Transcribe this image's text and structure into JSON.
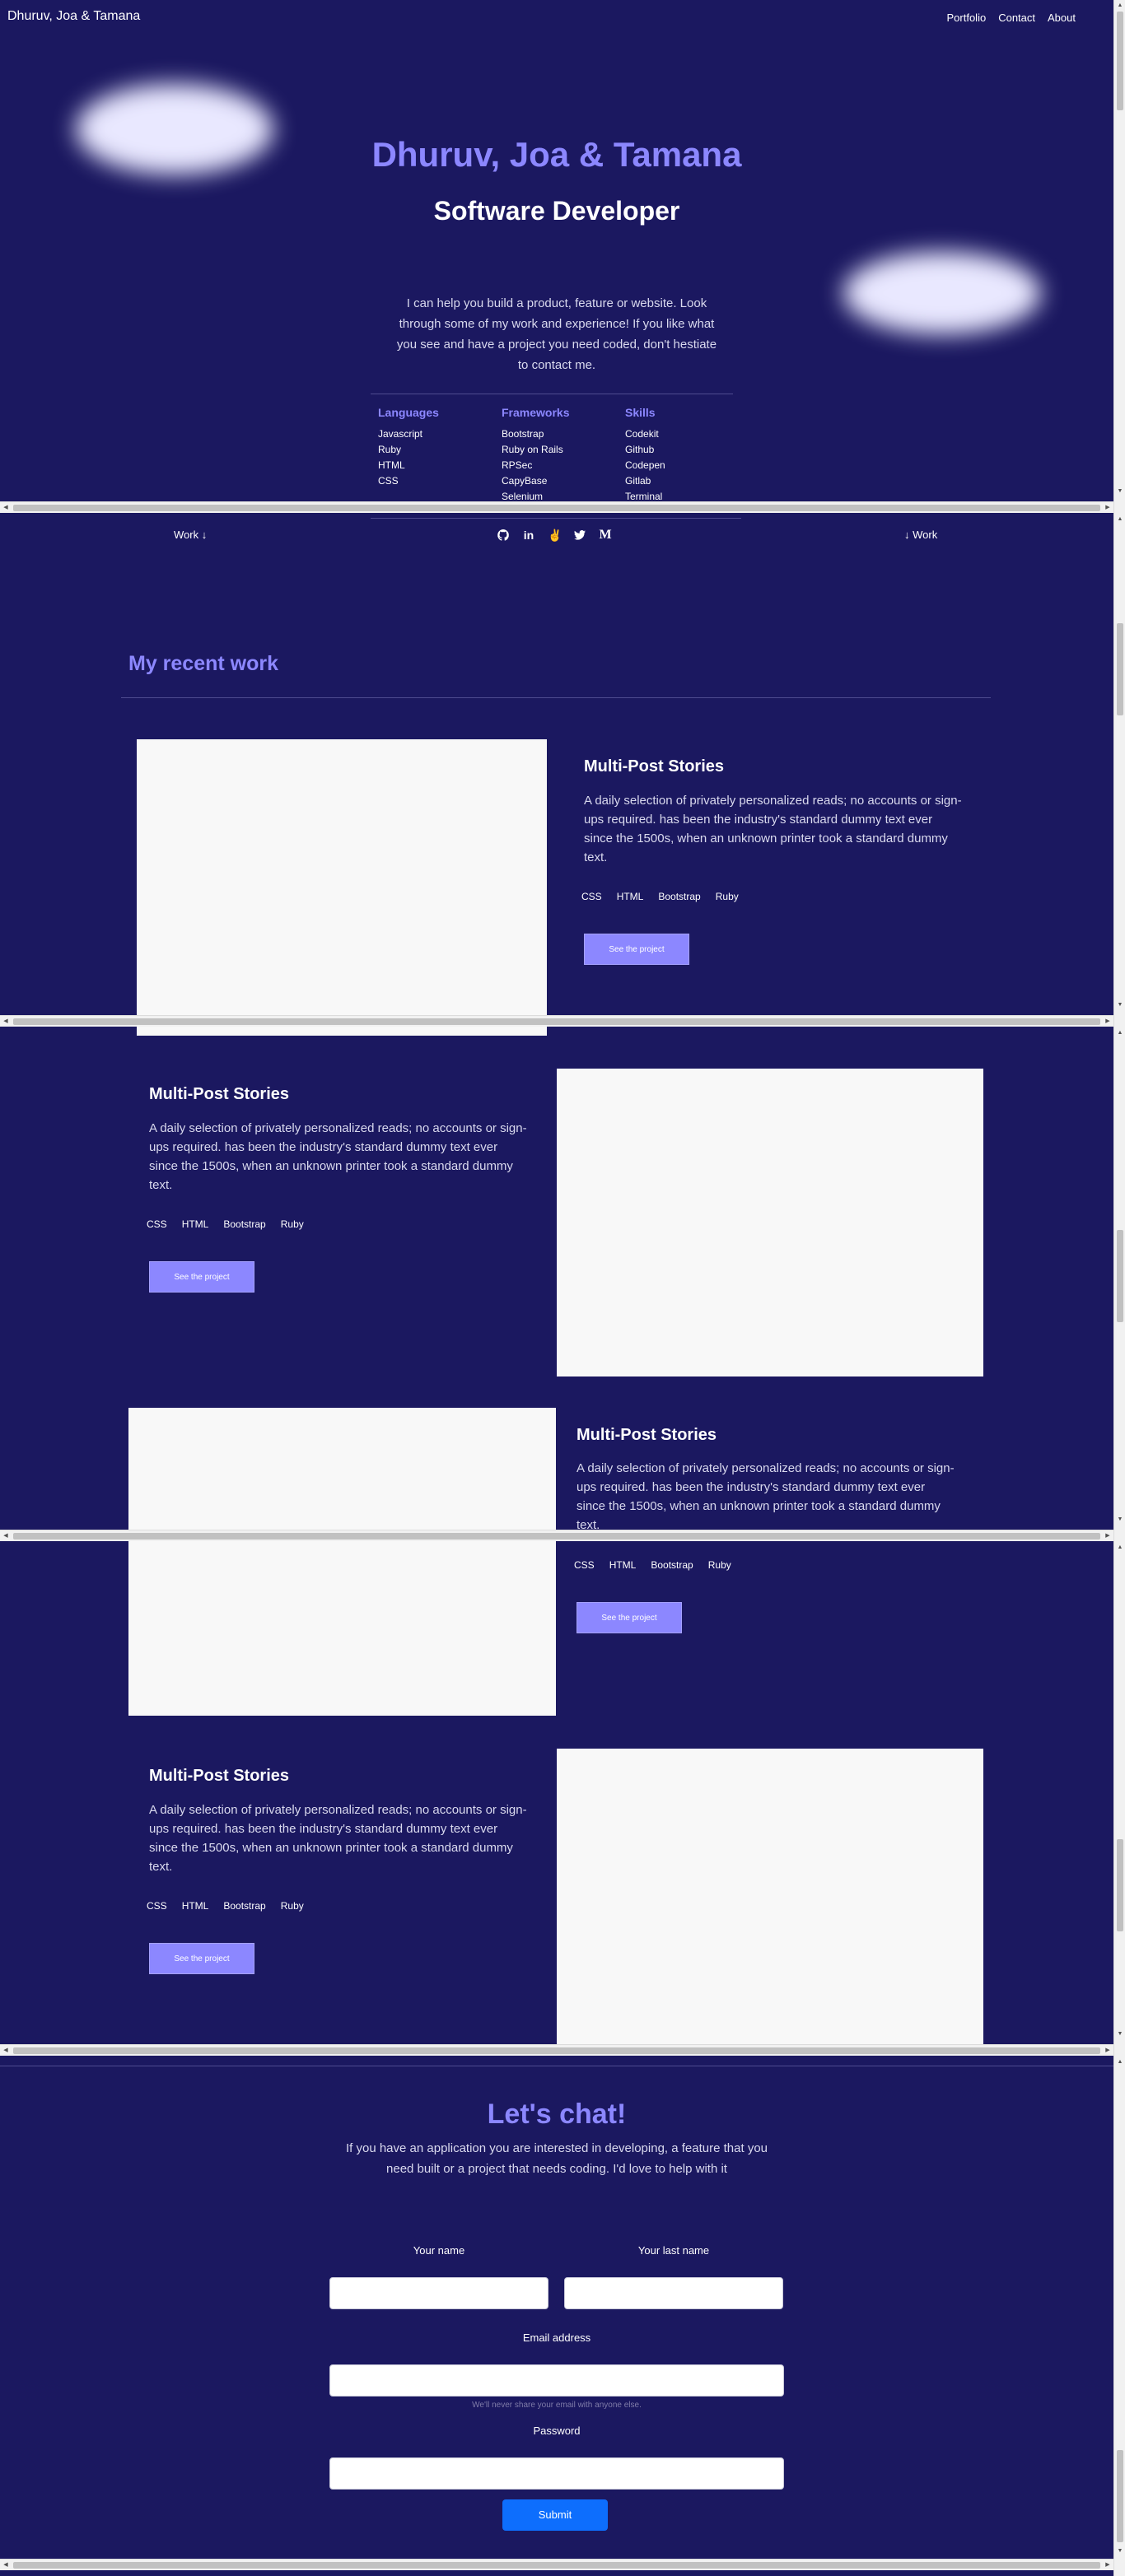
{
  "header": {
    "brand": "Dhuruv, Joa & Tamana",
    "nav": [
      "Portfolio",
      "Contact",
      "About"
    ]
  },
  "hero": {
    "name": "Dhuruv, Joa & Tamana",
    "role": "Software Developer",
    "intro": "I can help you build a product, feature or website. Look through some of my work and experience! If you like what you see and have a project you need coded, don't hestiate to contact me."
  },
  "tech": {
    "languages": {
      "title": "Languages",
      "items": [
        "Javascript",
        "Ruby",
        "HTML",
        "CSS"
      ]
    },
    "frameworks": {
      "title": "Frameworks",
      "items": [
        "Bootstrap",
        "Ruby on Rails",
        "RPSec",
        "CapyBase",
        "Selenium"
      ]
    },
    "skills": {
      "title": "Skills",
      "items": [
        "Codekit",
        "Github",
        "Codepen",
        "Gitlab",
        "Terminal"
      ]
    }
  },
  "workbar": {
    "left": "Work ↓",
    "right": "↓ Work"
  },
  "social_icons": [
    "github-icon",
    "linkedin-icon",
    "angellist-icon",
    "twitter-icon",
    "medium-icon"
  ],
  "section": {
    "title": "My recent work"
  },
  "projects": [
    {
      "title": "Multi-Post Stories",
      "description": "A daily selection of privately personalized reads; no accounts or sign-ups required. has been the industry's standard dummy text ever since the 1500s, when an unknown printer took a standard dummy text.",
      "tags": [
        "CSS",
        "HTML",
        "Bootstrap",
        "Ruby"
      ],
      "button": "See the project"
    },
    {
      "title": "Multi-Post Stories",
      "description": "A daily selection of privately personalized reads; no accounts or sign-ups required. has been the industry's standard dummy text ever since the 1500s, when an unknown printer took a standard dummy text.",
      "tags": [
        "CSS",
        "HTML",
        "Bootstrap",
        "Ruby"
      ],
      "button": "See the project"
    },
    {
      "title": "Multi-Post Stories",
      "description": "A daily selection of privately personalized reads; no accounts or sign-ups required. has been the industry's standard dummy text ever since the 1500s, when an unknown printer took a standard dummy text.",
      "tags": [
        "CSS",
        "HTML",
        "Bootstrap",
        "Ruby"
      ],
      "button": "See the project"
    },
    {
      "title": "Multi-Post Stories",
      "description": "A daily selection of privately personalized reads; no accounts or sign-ups required. has been the industry's standard dummy text ever since the 1500s, when an unknown printer took a standard dummy text.",
      "tags": [
        "CSS",
        "HTML",
        "Bootstrap",
        "Ruby"
      ],
      "button": "See the project"
    }
  ],
  "contact": {
    "title": "Let's chat!",
    "text": "If you have an application you are interested in developing, a feature that you need built or a project that needs coding. I'd love to help with it",
    "first_name_label": "Your name",
    "last_name_label": "Your last name",
    "email_label": "Email address",
    "email_help": "We'll never share your email with anyone else.",
    "password_label": "Password",
    "submit": "Submit"
  },
  "colors": {
    "background": "#1b1860",
    "accent": "#8c87ff",
    "submit": "#0d6efd"
  }
}
